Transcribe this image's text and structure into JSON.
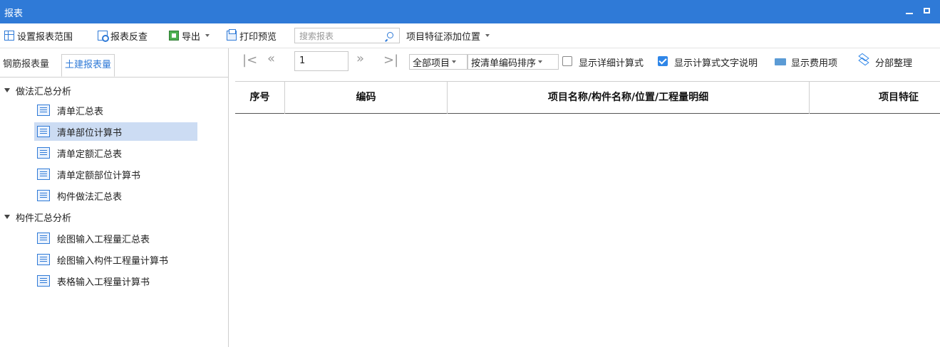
{
  "window": {
    "title": "报表"
  },
  "toolbar": {
    "set_range": "设置报表范围",
    "reverse_check": "报表反查",
    "export": "导出",
    "print_preview": "打印预览",
    "search_placeholder": "搜索报表",
    "feature_position": "项目特征添加位置"
  },
  "left": {
    "tabs": [
      "钢筋报表量",
      "土建报表量"
    ],
    "active_tab": 1,
    "groups": [
      {
        "label": "做法汇总分析",
        "items": [
          "清单汇总表",
          "清单部位计算书",
          "清单定额汇总表",
          "清单定额部位计算书",
          "构件做法汇总表"
        ]
      },
      {
        "label": "构件汇总分析",
        "items": [
          "绘图输入工程量汇总表",
          "绘图输入构件工程量计算书",
          "表格输入工程量计算书"
        ]
      }
    ],
    "selected_item": "清单部位计算书"
  },
  "right": {
    "page_value": "1",
    "scope_dropdown": "全部项目",
    "sort_dropdown": "按清单编码排序",
    "show_detail_formula": "显示详细计算式",
    "show_detail_checked": false,
    "show_formula_desc": "显示计算式文字说明",
    "show_formula_desc_checked": true,
    "show_fee_items": "显示费用项",
    "partial_arrange": "分部整理",
    "columns": [
      "序号",
      "编码",
      "项目名称/构件名称/位置/工程量明细",
      "项目特征"
    ]
  },
  "colors": {
    "accent": "#2f7ad7",
    "selected": "#ccdcf3"
  }
}
